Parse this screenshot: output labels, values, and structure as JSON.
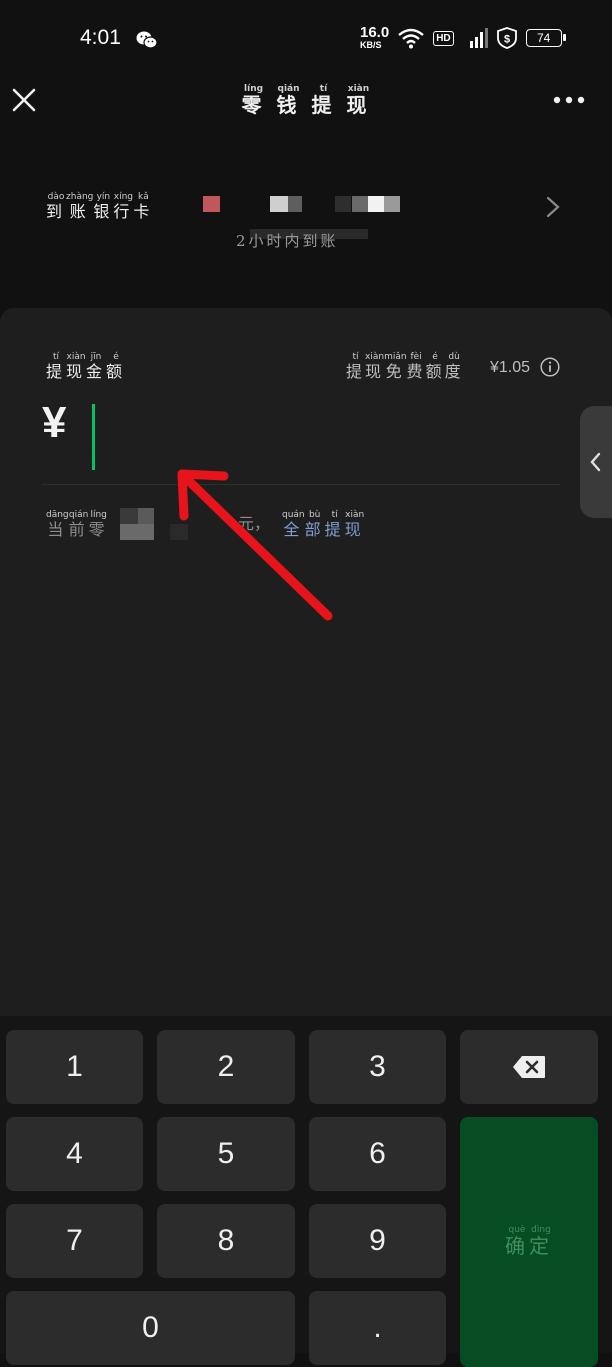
{
  "status": {
    "time": "4:01",
    "speed_value": "16.0",
    "speed_unit": "KB/S",
    "hd": "HD",
    "net": "4G",
    "battery": "74"
  },
  "header": {
    "title_chars": [
      {
        "char": "零",
        "pinyin": "líng"
      },
      {
        "char": "钱",
        "pinyin": "qián"
      },
      {
        "char": "提",
        "pinyin": "tí"
      },
      {
        "char": "现",
        "pinyin": "xiàn"
      }
    ]
  },
  "bank": {
    "label_chars": [
      {
        "char": "到",
        "pinyin": "dào"
      },
      {
        "char": "账",
        "pinyin": "zhàng"
      },
      {
        "char": "银",
        "pinyin": "yín"
      },
      {
        "char": "行",
        "pinyin": "xíng"
      },
      {
        "char": "卡",
        "pinyin": "kǎ"
      }
    ],
    "arrival_text": "2小时内到账"
  },
  "form": {
    "amount_label_chars": [
      {
        "char": "提",
        "pinyin": "tí"
      },
      {
        "char": "现",
        "pinyin": "xiàn"
      },
      {
        "char": "金",
        "pinyin": "jīn"
      },
      {
        "char": "额",
        "pinyin": "é"
      }
    ],
    "quota_chars": [
      {
        "char": "提",
        "pinyin": "tí"
      },
      {
        "char": "现",
        "pinyin": "xiàn"
      },
      {
        "char": "免",
        "pinyin": "miǎn"
      },
      {
        "char": "费",
        "pinyin": "fèi"
      },
      {
        "char": "额",
        "pinyin": "é"
      },
      {
        "char": "度",
        "pinyin": "dù"
      }
    ],
    "quota_amount": "¥1.05",
    "currency_symbol": "¥",
    "balance_prefix_chars": [
      {
        "char": "当",
        "pinyin": "dāng"
      },
      {
        "char": "前",
        "pinyin": "qián"
      },
      {
        "char": "零",
        "pinyin": "líng"
      }
    ],
    "balance_suffix": "元，",
    "withdraw_all_chars": [
      {
        "char": "全",
        "pinyin": "quán"
      },
      {
        "char": "部",
        "pinyin": "bù"
      },
      {
        "char": "提",
        "pinyin": "tí"
      },
      {
        "char": "现",
        "pinyin": "xiàn"
      }
    ]
  },
  "keypad": {
    "keys": [
      "1",
      "2",
      "3",
      "4",
      "5",
      "6",
      "7",
      "8",
      "9",
      "0",
      "."
    ],
    "confirm_chars": [
      {
        "char": "确",
        "pinyin": "què"
      },
      {
        "char": "定",
        "pinyin": "dìng"
      }
    ]
  },
  "colors": {
    "accent": "#07c160",
    "confirm_bg": "#064d23",
    "link": "#7f9fce",
    "arrow": "#e8141b"
  }
}
